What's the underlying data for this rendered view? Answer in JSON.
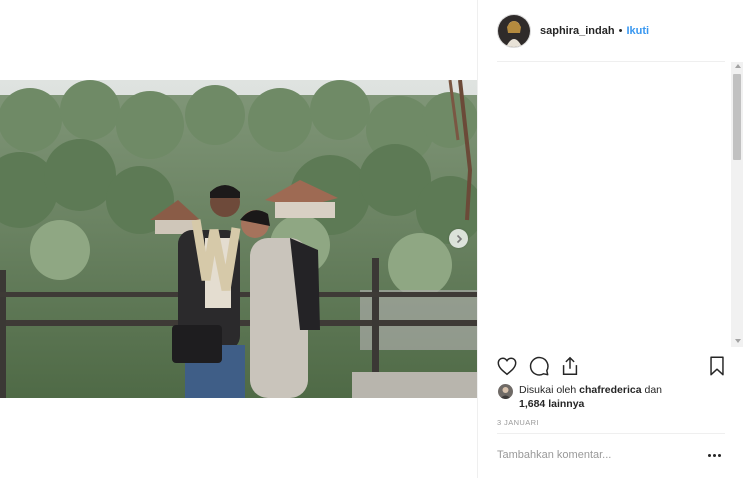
{
  "post": {
    "username": "saphira_indah",
    "separator": "•",
    "follow_label": "Ikuti",
    "likes": {
      "prefix": "Disukai oleh",
      "liker": "chafrederica",
      "connector": "dan",
      "others": "1,684 lainnya"
    },
    "date": "3 JANUARI",
    "comment_placeholder": "Tambahkan komentar..."
  },
  "icons": {
    "like": "heart-icon",
    "comment": "comment-bubble-icon",
    "share": "share-icon",
    "save": "bookmark-icon",
    "more": "more-options-icon",
    "next": "chevron-right-icon"
  },
  "colors": {
    "accent": "#3897f0",
    "text": "#262626",
    "muted": "#999999",
    "divider": "#efefef"
  }
}
